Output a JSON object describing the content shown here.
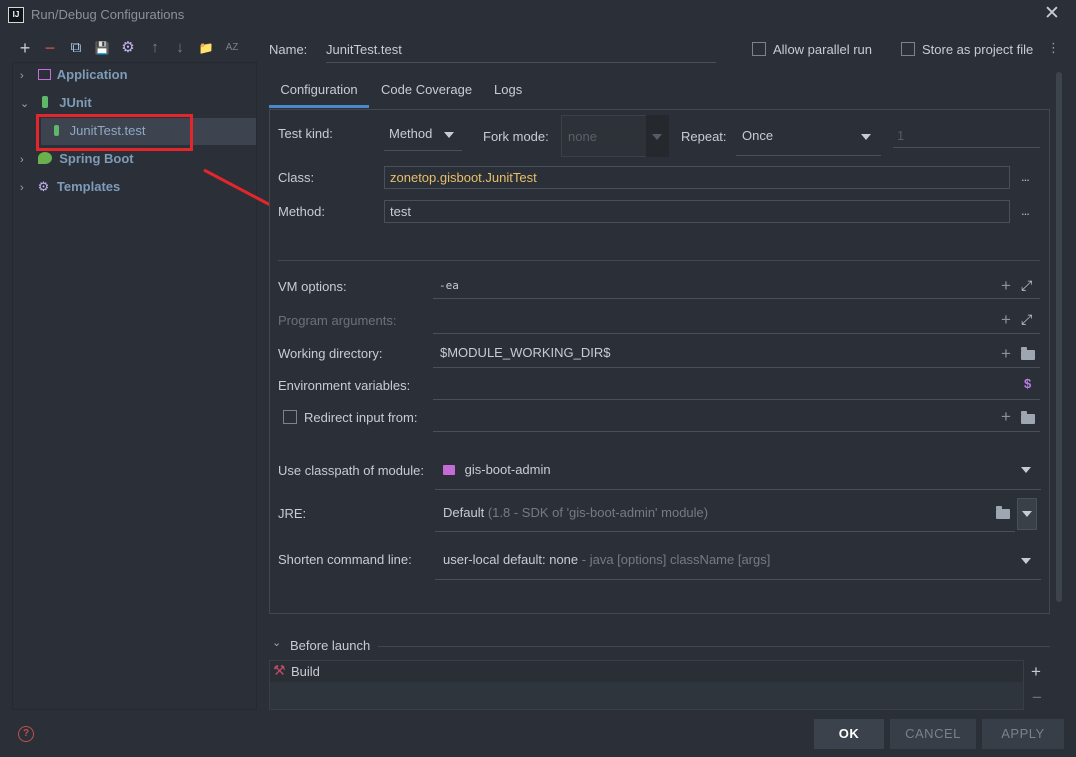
{
  "window": {
    "title": "Run/Debug Configurations",
    "app_icon": "IJ",
    "close": "✕"
  },
  "toolbar": {
    "add": "+",
    "remove": "−",
    "copy": "⧉",
    "save": "💾",
    "settings": "⚙",
    "up": "↑",
    "down": "↓",
    "folder": "📁",
    "sort": "AZ"
  },
  "tree": {
    "items": [
      {
        "label": "Application",
        "chev": "›"
      },
      {
        "label": "JUnit",
        "chev": "⌄"
      },
      {
        "label": "JunitTest.test"
      },
      {
        "label": "Spring Boot",
        "chev": "›"
      },
      {
        "label": "Templates",
        "chev": "›"
      }
    ]
  },
  "header": {
    "name_label": "Name:",
    "name_value": "JunitTest.test",
    "allow_parallel": "Allow parallel run",
    "store_project": "Store as project file",
    "menu_dots": "⋮"
  },
  "tabs": [
    "Configuration",
    "Code Coverage",
    "Logs"
  ],
  "config": {
    "test_kind_label": "Test kind:",
    "test_kind_value": "Method",
    "fork_mode_label": "Fork mode:",
    "fork_mode_value": "none",
    "repeat_label": "Repeat:",
    "repeat_value": "Once",
    "repeat_count": "1",
    "class_label": "Class:",
    "class_value": "zonetop.gisboot.JunitTest",
    "method_label": "Method:",
    "method_value": "test",
    "more": "...",
    "vm_label": "VM options:",
    "vm_value": "-ea",
    "program_args_label": "Program arguments:",
    "workdir_label": "Working directory:",
    "workdir_value": "$MODULE_WORKING_DIR$",
    "env_label": "Environment variables:",
    "env_icon": "$",
    "redirect_label": "Redirect input from:",
    "classpath_label": "Use classpath of module:",
    "classpath_value": "gis-boot-admin",
    "jre_label": "JRE:",
    "jre_value": "Default",
    "jre_detail": "(1.8 - SDK of 'gis-boot-admin' module)",
    "shorten_label": "Shorten command line:",
    "shorten_value": "user-local default: none",
    "shorten_detail": "- java [options] className [args]",
    "plus": "+",
    "expand": "⤢"
  },
  "before_launch": {
    "title": "Before launch",
    "chev": "⌄",
    "item": "Build",
    "add": "+",
    "remove": "−"
  },
  "buttons": {
    "ok": "OK",
    "cancel": "CANCEL",
    "apply": "APPLY"
  },
  "help": "?"
}
